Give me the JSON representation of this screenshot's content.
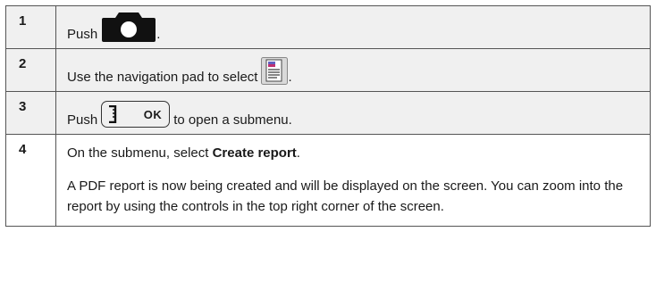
{
  "steps": [
    {
      "number": "1",
      "text_before": "Push",
      "icon": "camera-icon",
      "text_after": "."
    },
    {
      "number": "2",
      "text_before": "Use the navigation pad to select",
      "icon": "report-icon",
      "text_after": "."
    },
    {
      "number": "3",
      "text_before": "Push",
      "button_label": "OK",
      "icon": "ok-button",
      "text_after": "to open a submenu."
    },
    {
      "number": "4",
      "instruction_prefix": "On the submenu, select ",
      "instruction_bold": "Create report",
      "instruction_suffix": ".",
      "description": "A PDF report is now being created and will be displayed on the screen. You can zoom into the report by using the controls in the top right corner of the screen."
    }
  ]
}
